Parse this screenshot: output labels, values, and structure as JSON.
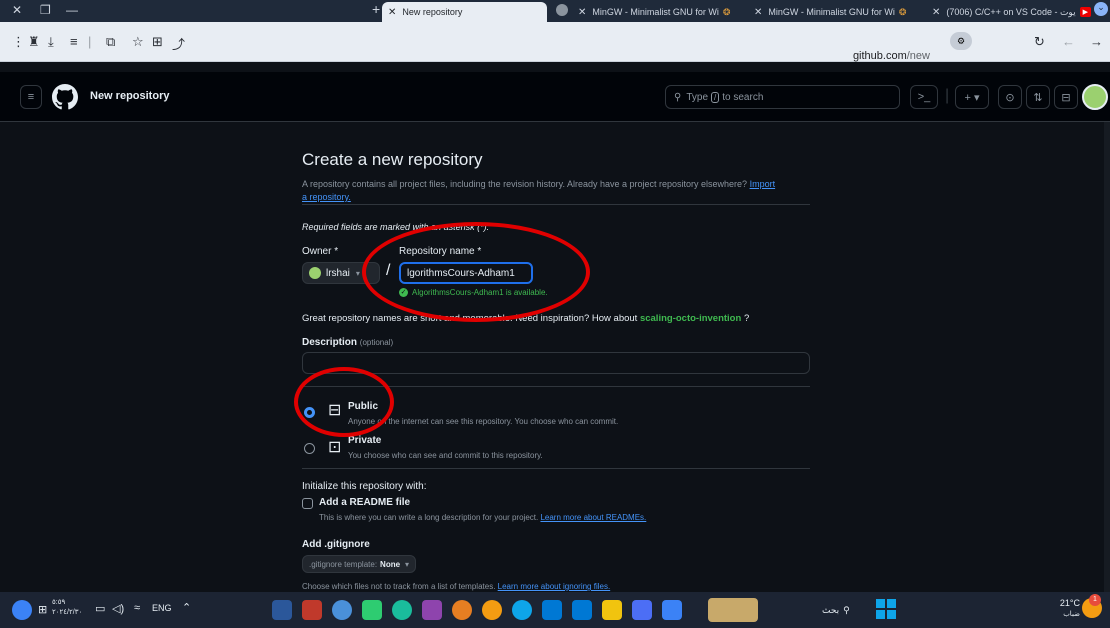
{
  "browser": {
    "tabs": [
      {
        "label": "New repository",
        "active": true
      },
      {
        "label": "MinGW - Minimalist GNU for Wi",
        "active": false
      },
      {
        "label": "MinGW - Minimalist GNU for Wi",
        "active": false
      },
      {
        "label": "(7006) C/C++ on VS Code - يوت",
        "active": false
      }
    ],
    "url": {
      "domain": "github.com",
      "path": "/new"
    }
  },
  "header": {
    "title": "New repository",
    "search_prefix": "Type",
    "search_key": "/",
    "search_suffix": "to search"
  },
  "page": {
    "title": "Create a new repository",
    "description": "A repository contains all project files, including the revision history. Already have a project repository elsewhere?",
    "import_link": "Import a repository.",
    "required_note": "Required fields are marked with an asterisk (*).",
    "owner_label": "Owner *",
    "owner_value": "lrshai",
    "repo_label": "Repository name *",
    "repo_value": "lgorithmsCours-Adham1",
    "available_msg": "AlgorithmsCours-Adham1 is available.",
    "inspiration_text": "Great repository names are short and memorable. Need inspiration? How about",
    "suggestion": "scaling-octo-invention",
    "suggestion_suffix": "?",
    "description_label": "Description",
    "description_optional": "(optional)",
    "public_label": "Public",
    "public_desc": "Anyone on the internet can see this repository. You choose who can commit.",
    "private_label": "Private",
    "private_desc": "You choose who can see and commit to this repository.",
    "init_title": "Initialize this repository with:",
    "readme_label": "Add a README file",
    "readme_desc": "This is where you can write a long description for your project.",
    "readme_link": "Learn more about READMEs.",
    "gitignore_title": "Add .gitignore",
    "gitignore_select_prefix": ".gitignore template:",
    "gitignore_select_value": "None",
    "gitignore_desc": "Choose which files not to track from a list of templates.",
    "gitignore_link": "Learn more about ignoring files."
  },
  "taskbar": {
    "time": "٥:٥٩",
    "date": "٢٠٢٤/٢/٣٠",
    "lang": "ENG",
    "search_label": "بحث",
    "weather": "21°C",
    "weather_desc": "ضباب",
    "notif_count": "1"
  },
  "colors": {
    "accent_green": "#3fb950",
    "link_blue": "#4493f8",
    "annotation_red": "#e00000",
    "background": "#0d1117"
  }
}
